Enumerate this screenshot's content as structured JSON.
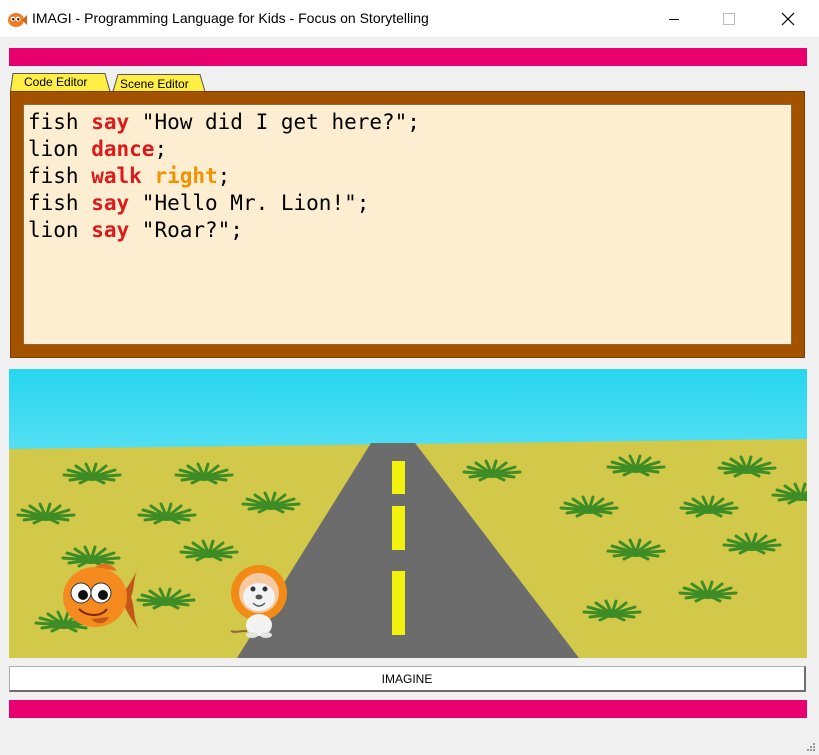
{
  "window": {
    "title": "IMAGI - Programming Language for Kids - Focus on Storytelling",
    "app_icon": "fish-icon",
    "controls": [
      "minimize-icon",
      "maximize-icon",
      "close-icon"
    ]
  },
  "colors": {
    "accent_bar": "#e8006f",
    "editor_frame": "#a35200",
    "editor_bg": "#fdeed2",
    "keyword_red": "#dd1a1a",
    "keyword_orange": "#f39200",
    "tab_yellow": "#ffee44"
  },
  "tabs": [
    {
      "label": "Code Editor",
      "active": true
    },
    {
      "label": "Scene Editor",
      "active": false
    }
  ],
  "code": [
    [
      {
        "t": "fish ",
        "k": "plain"
      },
      {
        "t": "say",
        "k": "red"
      },
      {
        "t": " \"How did I get here?\";",
        "k": "plain"
      }
    ],
    [
      {
        "t": "lion ",
        "k": "plain"
      },
      {
        "t": "dance",
        "k": "red"
      },
      {
        "t": ";",
        "k": "plain"
      }
    ],
    [
      {
        "t": "fish ",
        "k": "plain"
      },
      {
        "t": "walk",
        "k": "red"
      },
      {
        "t": " ",
        "k": "plain"
      },
      {
        "t": "right",
        "k": "orange"
      },
      {
        "t": ";",
        "k": "plain"
      }
    ],
    [
      {
        "t": "fish ",
        "k": "plain"
      },
      {
        "t": "say",
        "k": "red"
      },
      {
        "t": " \"Hello Mr. Lion!\";",
        "k": "plain"
      }
    ],
    [
      {
        "t": "lion ",
        "k": "plain"
      },
      {
        "t": "say",
        "k": "red"
      },
      {
        "t": " \"Roar?\";",
        "k": "plain"
      }
    ]
  ],
  "scene": {
    "characters": [
      "fish",
      "lion"
    ],
    "elements": [
      "sky",
      "desert-ground",
      "road",
      "grass-tufts"
    ]
  },
  "imagine_button": {
    "label": "IMAGINE"
  }
}
